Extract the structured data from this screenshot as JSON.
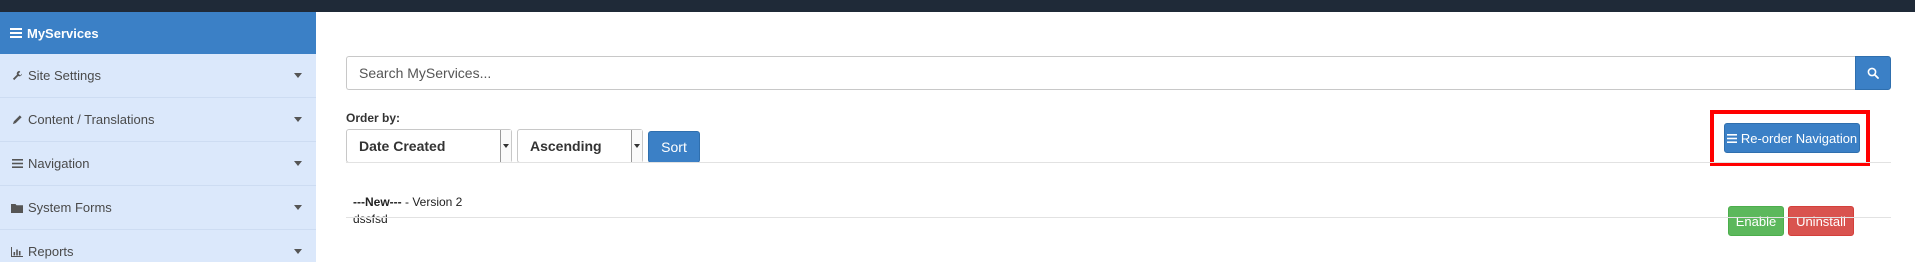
{
  "sidebar": {
    "header": {
      "label": "MyServices",
      "icon": "list-icon"
    },
    "items": [
      {
        "label": "Site Settings",
        "icon": "wrench-icon"
      },
      {
        "label": "Content / Translations",
        "icon": "pencil-icon"
      },
      {
        "label": "Navigation",
        "icon": "bars-icon"
      },
      {
        "label": "System Forms",
        "icon": "folder-icon"
      },
      {
        "label": "Reports",
        "icon": "bar-chart-icon"
      }
    ]
  },
  "search": {
    "placeholder": "Search MyServices..."
  },
  "order": {
    "label": "Order by:",
    "field_selected": "Date Created",
    "direction_selected": "Ascending",
    "sort_label": "Sort"
  },
  "reorder": {
    "label": "Re-order Navigation"
  },
  "service": {
    "name": "---New---",
    "version": " - Version 2",
    "description": "dssfsd",
    "enable_label": "Enable",
    "uninstall_label": "Uninstall"
  },
  "colors": {
    "primary": "#3b80c6",
    "success": "#5cb85c",
    "danger": "#d9534f",
    "sidebar_bg": "#dbe8fb",
    "highlight": "#ff0000"
  }
}
